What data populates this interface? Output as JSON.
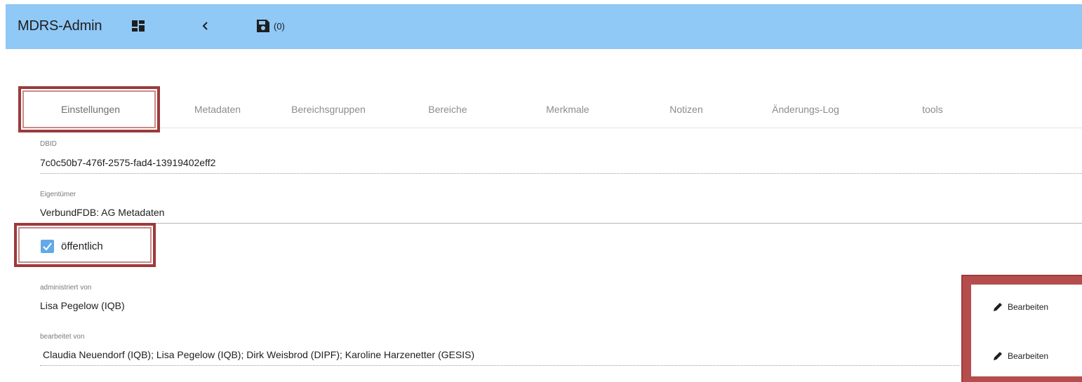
{
  "app": {
    "title": "MDRS-Admin"
  },
  "toolbar": {
    "icons": [
      "dashboard-icon",
      "chevron-left-icon",
      "save-icon"
    ],
    "save_count": "(0)"
  },
  "tabs": [
    {
      "label": "Einstellungen",
      "active": true
    },
    {
      "label": "Metadaten"
    },
    {
      "label": "Bereichsgruppen"
    },
    {
      "label": "Bereiche"
    },
    {
      "label": "Merkmale"
    },
    {
      "label": "Notizen"
    },
    {
      "label": "Änderungs-Log"
    },
    {
      "label": "tools"
    }
  ],
  "fields": {
    "dbid": {
      "label": "DBID",
      "value": "7c0c50b7-476f-2575-fad4-13919402eff2"
    },
    "owner": {
      "label": "Eigentümer",
      "value": "VerbundFDB: AG Metadaten"
    },
    "public": {
      "label": "öffentlich",
      "checked": true
    },
    "admin": {
      "label": "administriert von",
      "value": "Lisa Pegelow (IQB)"
    },
    "editors": {
      "label": "bearbeitet von",
      "value": "Claudia Neuendorf (IQB); Lisa Pegelow (IQB); Dirk Weisbrod (DIPF); Karoline Harzenetter (GESIS)"
    }
  },
  "actions": {
    "edit_label": "Bearbeiten"
  },
  "colors": {
    "toolbar_bg": "#90c8f6",
    "highlight": "#9d3a3a",
    "checkbox": "#64a8e8"
  }
}
